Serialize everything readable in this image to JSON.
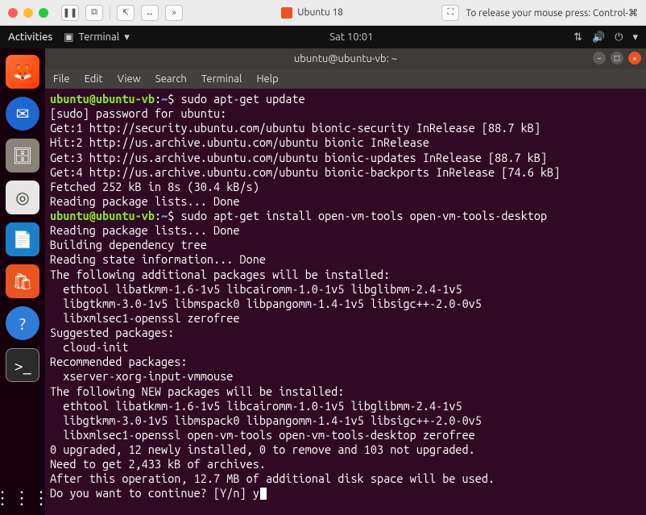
{
  "host": {
    "tab_label": "Ubuntu 18",
    "release_hint": "To release your mouse press: Control-⌘"
  },
  "gnome": {
    "activities": "Activities",
    "app_label": "Terminal",
    "clock": "Sat 10:01"
  },
  "window": {
    "title": "ubuntu@ubuntu-vb: ~"
  },
  "menu": {
    "file": "File",
    "edit": "Edit",
    "view": "View",
    "search": "Search",
    "terminal": "Terminal",
    "help": "Help"
  },
  "prompt": {
    "user": "ubuntu",
    "at": "@",
    "host": "ubuntu-vb",
    "path": "~",
    "sigil": "$"
  },
  "cmds": {
    "c1": "sudo apt-get update",
    "c2": "sudo apt-get install open-vm-tools open-vm-tools-desktop"
  },
  "out": {
    "l0": "[sudo] password for ubuntu:",
    "l1": "Get:1 http://security.ubuntu.com/ubuntu bionic-security InRelease [88.7 kB]",
    "l2": "Hit:2 http://us.archive.ubuntu.com/ubuntu bionic InRelease",
    "l3": "Get:3 http://us.archive.ubuntu.com/ubuntu bionic-updates InRelease [88.7 kB]",
    "l4": "Get:4 http://us.archive.ubuntu.com/ubuntu bionic-backports InRelease [74.6 kB]",
    "l5": "Fetched 252 kB in 8s (30.4 kB/s)",
    "l6": "Reading package lists... Done",
    "l7": "Reading package lists... Done",
    "l8": "Building dependency tree",
    "l9": "Reading state information... Done",
    "l10": "The following additional packages will be installed:",
    "l11": "  ethtool libatkmm-1.6-1v5 libcairomm-1.0-1v5 libglibmm-2.4-1v5",
    "l12": "  libgtkmm-3.0-1v5 libmspack0 libpangomm-1.4-1v5 libsigc++-2.0-0v5",
    "l13": "  libxmlsec1-openssl zerofree",
    "l14": "Suggested packages:",
    "l15": "  cloud-init",
    "l16": "Recommended packages:",
    "l17": "  xserver-xorg-input-vmmouse",
    "l18": "The following NEW packages will be installed:",
    "l19": "  ethtool libatkmm-1.6-1v5 libcairomm-1.0-1v5 libglibmm-2.4-1v5",
    "l20": "  libgtkmm-3.0-1v5 libmspack0 libpangomm-1.4-1v5 libsigc++-2.0-0v5",
    "l21": "  libxmlsec1-openssl open-vm-tools open-vm-tools-desktop zerofree",
    "l22": "0 upgraded, 12 newly installed, 0 to remove and 103 not upgraded.",
    "l23": "Need to get 2,433 kB of archives.",
    "l24": "After this operation, 12.7 MB of additional disk space will be used.",
    "l25": "Do you want to continue? [Y/n] y"
  }
}
